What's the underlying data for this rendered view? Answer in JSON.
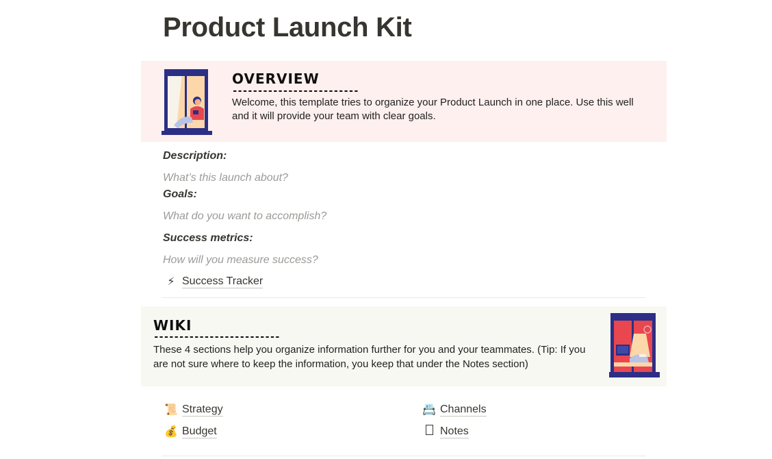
{
  "page": {
    "title": "Product Launch Kit"
  },
  "overview": {
    "heading": "OVERVIEW",
    "dashes": "-------------------------",
    "text": "Welcome, this template tries to organize your Product Launch in one place. Use this well and it will provide your team with clear goals."
  },
  "fields": {
    "description_label": "Description:",
    "description_placeholder": "What’s this launch about?",
    "goals_label": "Goals:",
    "goals_placeholder": "What do you want to accomplish?",
    "metrics_label": "Success metrics:",
    "metrics_placeholder": "How will you measure success?"
  },
  "success_tracker": {
    "emoji": "⚡",
    "label": "Success Tracker"
  },
  "wiki": {
    "heading": "WIKI",
    "dashes": "-------------------------",
    "text": "These 4 sections help you organize information further for you and your teammates. (Tip: If you are not sure where to keep the information, you keep that under the Notes section)"
  },
  "wiki_links": {
    "strategy": {
      "emoji": "📜",
      "label": "Strategy"
    },
    "channels": {
      "emoji": "📇",
      "label": "Channels"
    },
    "budget": {
      "emoji": "💰",
      "label": "Budget"
    },
    "notes": {
      "label": "Notes"
    }
  },
  "colors": {
    "overview_bg": "#fdf0ee",
    "wiki_bg": "#f8f8f3",
    "illustration_navy": "#2b2f86",
    "illustration_red": "#e8474f"
  }
}
